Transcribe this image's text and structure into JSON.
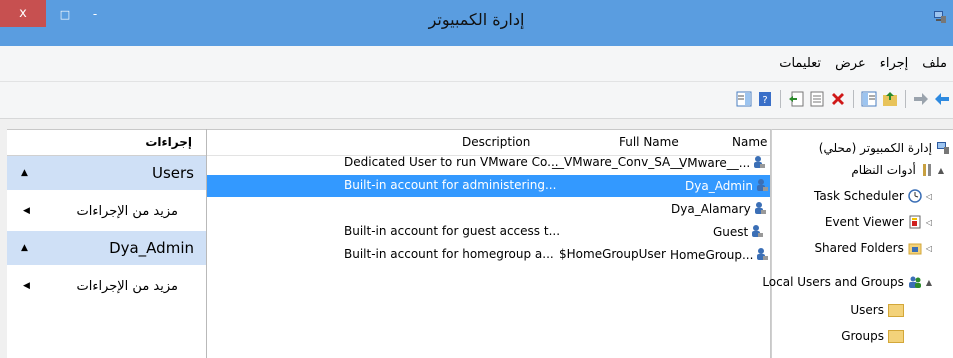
{
  "window": {
    "title": "إدارة الكمبيوتر",
    "close_glyph": "x",
    "maximize_glyph": "□",
    "minimize_glyph": "-"
  },
  "menu": {
    "items": [
      "ملف",
      "إجراء",
      "عرض",
      "تعليمات"
    ]
  },
  "toolbar": {
    "icons": [
      "back-arrow-icon",
      "forward-arrow-icon",
      "up-folder-icon",
      "show-tree-icon",
      "delete-icon",
      "properties-icon",
      "export-list-icon",
      "help-icon",
      "action-pane-icon"
    ]
  },
  "actions": {
    "header": "إجراءات",
    "sections": [
      {
        "title": "Users",
        "more": "مزيد من الإجراءات"
      },
      {
        "title": "Dya_Admin",
        "more": "مزيد من الإجراءات"
      }
    ]
  },
  "list": {
    "columns": {
      "name": "Name",
      "full_name": "Full Name",
      "description": "Description"
    },
    "rows": [
      {
        "name": "VMware__...",
        "full_name": "__VMware_Conv_SA__",
        "description": "Dedicated User to run VMware Co...",
        "selected": false
      },
      {
        "name": "Dya_Admin",
        "full_name": "",
        "description": "Built-in account for administering...",
        "selected": true
      },
      {
        "name": "Dya_Alamary",
        "full_name": "",
        "description": "",
        "selected": false
      },
      {
        "name": "Guest",
        "full_name": "",
        "description": "Built-in account for guest access t...",
        "selected": false
      },
      {
        "name": "HomeGroup...",
        "full_name": "$HomeGroupUser",
        "description": "Built-in account for homegroup a...",
        "selected": false
      }
    ]
  },
  "tree": {
    "root": "إدارة الكمبيوتر (محلي)",
    "system_tools": "أدوات النظام",
    "task_scheduler": "Task Scheduler",
    "event_viewer": "Event Viewer",
    "shared_folders": "Shared Folders",
    "local_users": "Local Users and Groups",
    "users": "Users",
    "groups": "Groups"
  },
  "colors": {
    "titlebar": "#5a9de0",
    "close": "#c75050",
    "selection": "#3399ff",
    "action_section": "#cfe0f6"
  }
}
